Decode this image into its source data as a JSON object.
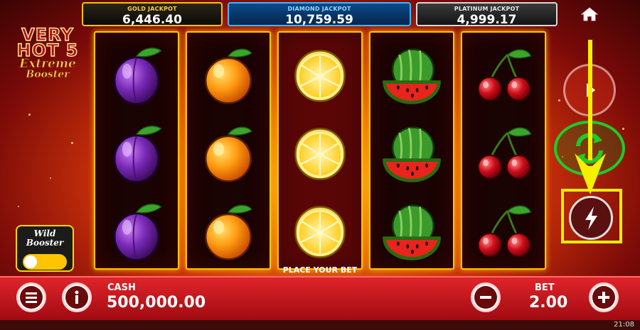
{
  "jackpots": {
    "gold": {
      "label": "GOLD JACKPOT",
      "value": "6,446.40"
    },
    "diamond": {
      "label": "DIAMOND JACKPOT",
      "value": "10,759.59"
    },
    "platinum": {
      "label": "PLATINUM JACKPOT",
      "value": "4,999.17"
    }
  },
  "logo": {
    "line1": "VERY",
    "line2": "HOT 5",
    "line3": "Extreme",
    "line4": "Booster"
  },
  "reels": [
    {
      "symbol": "plum"
    },
    {
      "symbol": "orange"
    },
    {
      "symbol": "lemon"
    },
    {
      "symbol": "watermelon"
    },
    {
      "symbol": "cherry"
    }
  ],
  "rows": 3,
  "status": "PLACE YOUR BET",
  "wild_booster": {
    "line1": "Wild",
    "line2": "Booster",
    "enabled": false
  },
  "cash": {
    "label": "CASH",
    "value": "500,000.00"
  },
  "bet": {
    "label": "BET",
    "value": "2.00"
  },
  "clock": "21:08",
  "icons": {
    "home": "home-icon",
    "play": "play-icon",
    "autoplay": "autoplay-icon",
    "turbo": "lightning-icon",
    "menu": "menu-icon",
    "info": "info-icon",
    "minus": "minus-icon",
    "plus": "plus-icon"
  },
  "colors": {
    "highlight_frame": "#f5ef00",
    "autoplay_ring": "#1ecb28",
    "reel_border": "#ffc400"
  }
}
